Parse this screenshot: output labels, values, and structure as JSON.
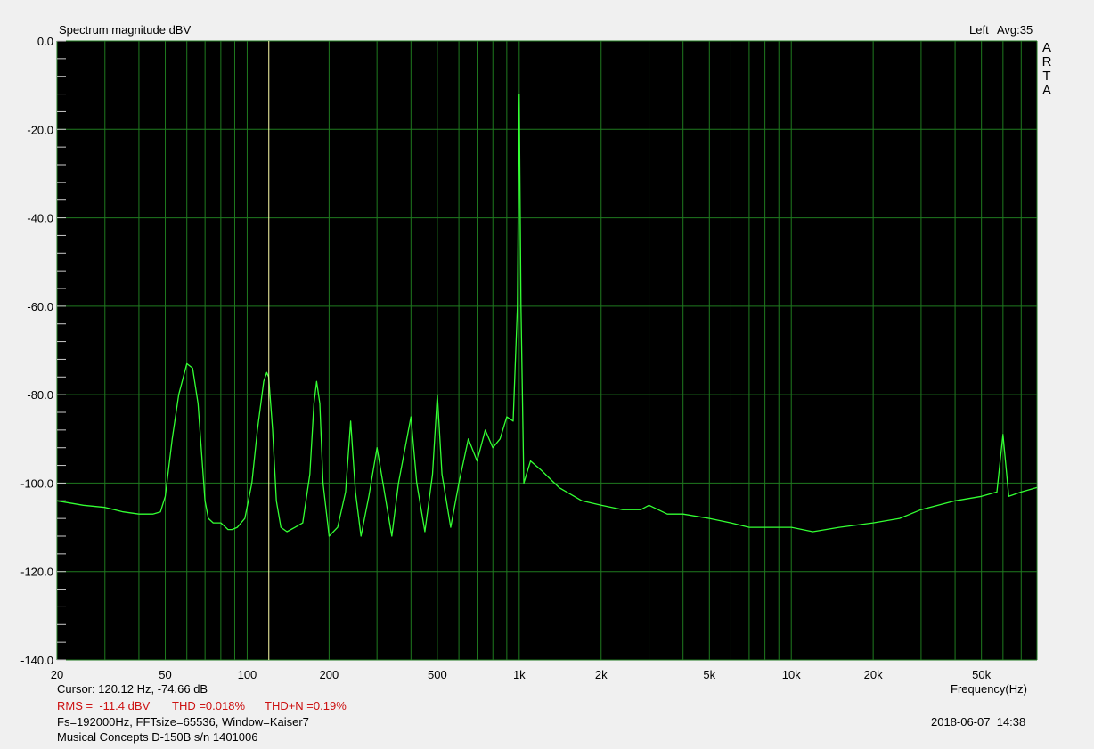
{
  "header": {
    "title": "Spectrum magnitude dBV",
    "channel": "Left",
    "averaging": "Avg:35",
    "side_logo": [
      "A",
      "R",
      "T",
      "A"
    ]
  },
  "footer": {
    "cursor": "Cursor: 120.12 Hz, -74.66 dB",
    "xlabel": "Frequency(Hz)",
    "rms": "RMS =  -11.4 dBV",
    "thd": "THD =0.018%",
    "thdn": "THD+N =0.19%",
    "fft_info": "Fs=192000Hz, FFTsize=65536, Window=Kaiser7",
    "timestamp": "2018-06-07  14:38",
    "device": "Musical Concepts D-150B s/n 1401006"
  },
  "colors": {
    "plot_bg": "#000000",
    "grid": "#1f7a1f",
    "trace": "#33ff33",
    "cursor": "#ffffaa",
    "stats_text": "#cc1111",
    "window_bg": "#f0f0f0"
  },
  "chart_data": {
    "type": "line",
    "title": "Spectrum magnitude dBV",
    "xlabel": "Frequency(Hz)",
    "ylabel": "",
    "xscale": "log",
    "xlim": [
      20,
      80000
    ],
    "ylim": [
      -140,
      0
    ],
    "grid": true,
    "x_ticks": [
      20,
      50,
      100,
      200,
      500,
      1000,
      2000,
      5000,
      10000,
      20000,
      50000
    ],
    "x_tick_labels": [
      "20",
      "50",
      "100",
      "200",
      "500",
      "1k",
      "2k",
      "5k",
      "10k",
      "20k",
      "50k"
    ],
    "y_ticks": [
      0,
      -20,
      -40,
      -60,
      -80,
      -100,
      -120,
      -140
    ],
    "y_tick_labels": [
      "0.0",
      "-20.0",
      "-40.0",
      "-60.0",
      "-80.0",
      "-100.0",
      "-120.0",
      "-140.0"
    ],
    "cursor": {
      "x": 120.12,
      "y": -74.66
    },
    "series": [
      {
        "x": [
          20,
          25,
          30,
          35,
          40,
          45,
          48,
          50,
          53,
          56,
          60,
          63,
          66,
          70,
          72,
          75,
          80,
          85,
          88,
          92,
          98,
          104,
          109,
          115,
          118,
          120,
          124,
          128,
          133,
          140,
          150,
          160,
          170,
          176,
          180,
          185,
          190,
          200,
          215,
          230,
          240,
          250,
          262,
          280,
          300,
          340,
          360,
          400,
          420,
          450,
          480,
          500,
          520,
          560,
          600,
          650,
          700,
          750,
          800,
          850,
          900,
          950,
          985,
          1000,
          1015,
          1040,
          1100,
          1200,
          1400,
          1700,
          2000,
          2400,
          2800,
          3000,
          3500,
          4000,
          5000,
          6000,
          7000,
          8000,
          10000,
          12000,
          15000,
          20000,
          25000,
          30000,
          40000,
          50000,
          57000,
          60000,
          63000,
          70000,
          80000
        ],
        "y": [
          -104,
          -105,
          -105.5,
          -106.5,
          -107,
          -107,
          -106.5,
          -103,
          -90,
          -80,
          -73,
          -74,
          -82,
          -104,
          -108,
          -109,
          -109,
          -110.5,
          -110.5,
          -110,
          -108,
          -100,
          -88,
          -77,
          -75,
          -76,
          -88,
          -104,
          -110,
          -111,
          -110,
          -109,
          -98,
          -82,
          -77,
          -82,
          -100,
          -112,
          -110,
          -102,
          -86,
          -102,
          -112,
          -103,
          -92,
          -112,
          -100,
          -85,
          -100,
          -111,
          -98,
          -80,
          -98,
          -110,
          -100,
          -90,
          -95,
          -88,
          -92,
          -90,
          -85,
          -86,
          -60,
          -12,
          -60,
          -100,
          -95,
          -97,
          -101,
          -104,
          -105,
          -106,
          -106,
          -105,
          -107,
          -107,
          -108,
          -109,
          -110,
          -110,
          -110,
          -111,
          -110,
          -109,
          -108,
          -106,
          -104,
          -103,
          -102,
          -89,
          -103,
          -102,
          -101
        ]
      }
    ]
  }
}
